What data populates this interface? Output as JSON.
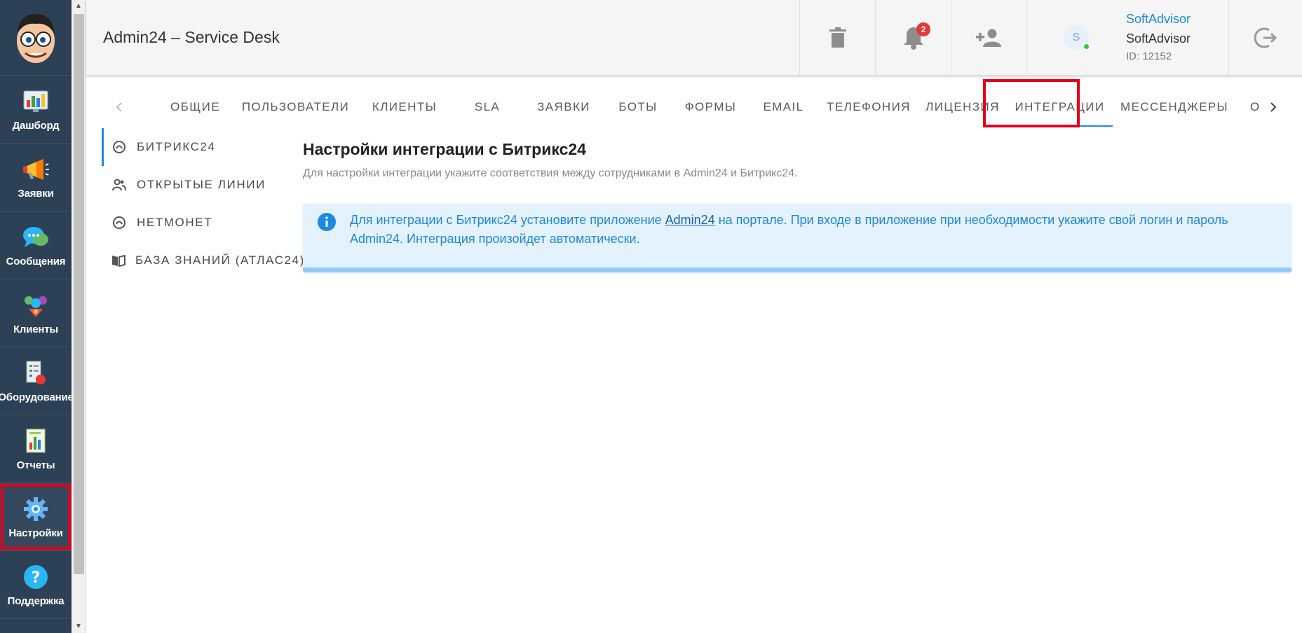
{
  "sidebar": {
    "items": [
      {
        "label": "Дашборд",
        "icon": "dashboard-icon"
      },
      {
        "label": "Заявки",
        "icon": "megaphone-icon"
      },
      {
        "label": "Сообщения",
        "icon": "chat-bubbles-icon"
      },
      {
        "label": "Клиенты",
        "icon": "clients-icon"
      },
      {
        "label": "Оборудование",
        "icon": "equipment-icon"
      },
      {
        "label": "Отчеты",
        "icon": "reports-icon"
      },
      {
        "label": "Настройки",
        "icon": "gear-icon",
        "active": true
      },
      {
        "label": "Поддержка",
        "icon": "help-icon"
      }
    ]
  },
  "header": {
    "title": "Admin24 – Service Desk",
    "notifications_count": "2",
    "user": {
      "avatar_letter": "S",
      "link_name": "SoftAdvisor",
      "name": "SoftAdvisor",
      "id_text": "ID: 12152"
    }
  },
  "tabs": [
    "ОБЩИЕ",
    "ПОЛЬЗОВАТЕЛИ",
    "КЛИЕНТЫ",
    "SLA",
    "ЗАЯВКИ",
    "БОТЫ",
    "ФОРМЫ",
    "EMAIL",
    "ТЕЛЕФОНИЯ",
    "ЛИЦЕНЗИЯ",
    "ИНТЕГРАЦИИ",
    "МЕССЕНДЖЕРЫ",
    "ОТКР"
  ],
  "active_tab": "ИНТЕГРАЦИИ",
  "subnav": [
    {
      "label": "БИТРИКС24",
      "icon": "bitrix-icon",
      "active": true
    },
    {
      "label": "ОТКРЫТЫЕ ЛИНИИ",
      "icon": "people-icon"
    },
    {
      "label": "НЕТМОНЕТ",
      "icon": "bitrix-icon"
    },
    {
      "label": "БАЗА ЗНАНИЙ (АТЛАС24)",
      "icon": "book-icon"
    }
  ],
  "content": {
    "title": "Настройки интеграции с Битрикс24",
    "subtitle": "Для настройки интеграции укажите соответствия между сотрудниками в Admin24 и Битрикс24.",
    "alert": {
      "text_before": "Для интеграции с Битрикс24 установите приложение ",
      "link": "Admin24",
      "text_after": " на портале. При входе в приложение при необходимости укажите свой логин и пароль Admin24. Интеграция произойдет автоматически."
    }
  },
  "colors": {
    "sidebar_bg": "#2c4155",
    "accent": "#1e88e5",
    "highlight": "#e3001b",
    "alert_bg": "#e3f2fd"
  }
}
